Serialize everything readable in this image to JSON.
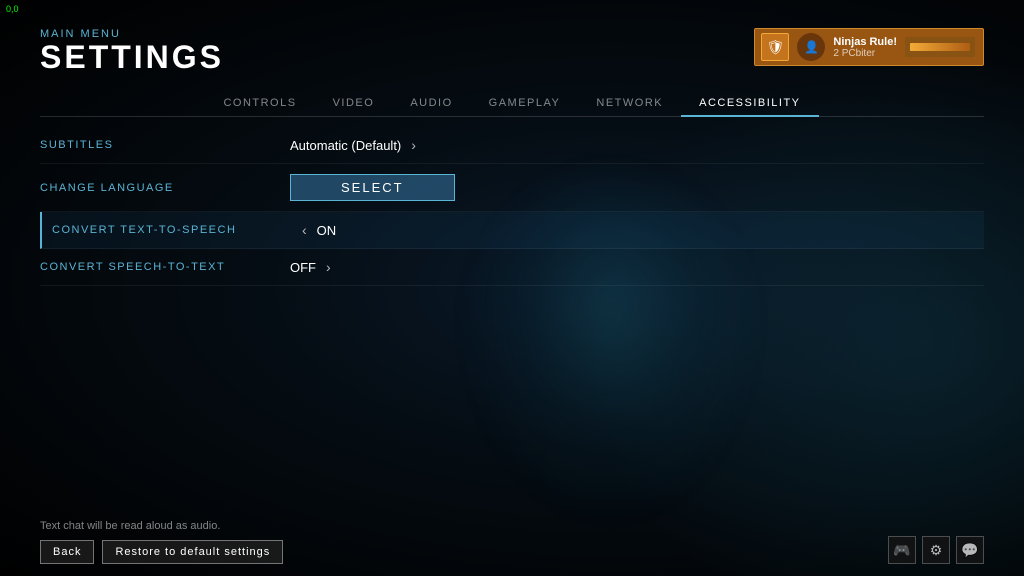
{
  "corner": "0,0",
  "header": {
    "breadcrumb": "MAIN MENU",
    "title": "SETTINGS"
  },
  "user": {
    "rank_icon": "🛡",
    "avatar_icon": "👤",
    "name": "Ninjas Rule!",
    "subtitle": "2 PCbiter"
  },
  "nav": {
    "tabs": [
      {
        "label": "CONTROLS",
        "active": false
      },
      {
        "label": "VIDEO",
        "active": false
      },
      {
        "label": "AUDIO",
        "active": false
      },
      {
        "label": "GAMEPLAY",
        "active": false
      },
      {
        "label": "NETWORK",
        "active": false
      },
      {
        "label": "ACCESSIBILITY",
        "active": true
      }
    ]
  },
  "settings": {
    "rows": [
      {
        "label": "SUBTITLES",
        "value": "Automatic (Default)",
        "chevron_right": true,
        "chevron_left": false,
        "has_button": false,
        "active": false
      },
      {
        "label": "CHANGE LANGUAGE",
        "value": "",
        "chevron_right": false,
        "chevron_left": false,
        "has_button": true,
        "button_label": "Select",
        "active": false
      },
      {
        "label": "CONVERT TEXT-TO-SPEECH",
        "value": "ON",
        "chevron_right": false,
        "chevron_left": true,
        "has_button": false,
        "active": true
      },
      {
        "label": "CONVERT SPEECH-TO-TEXT",
        "value": "OFF",
        "chevron_right": true,
        "chevron_left": false,
        "has_button": false,
        "active": false
      }
    ]
  },
  "bottom": {
    "hint": "Text chat will be read aloud as audio.",
    "back_label": "Back",
    "restore_label": "Restore to default settings",
    "icons": {
      "steam": "🎮",
      "settings": "⚙",
      "chat": "💬"
    }
  }
}
